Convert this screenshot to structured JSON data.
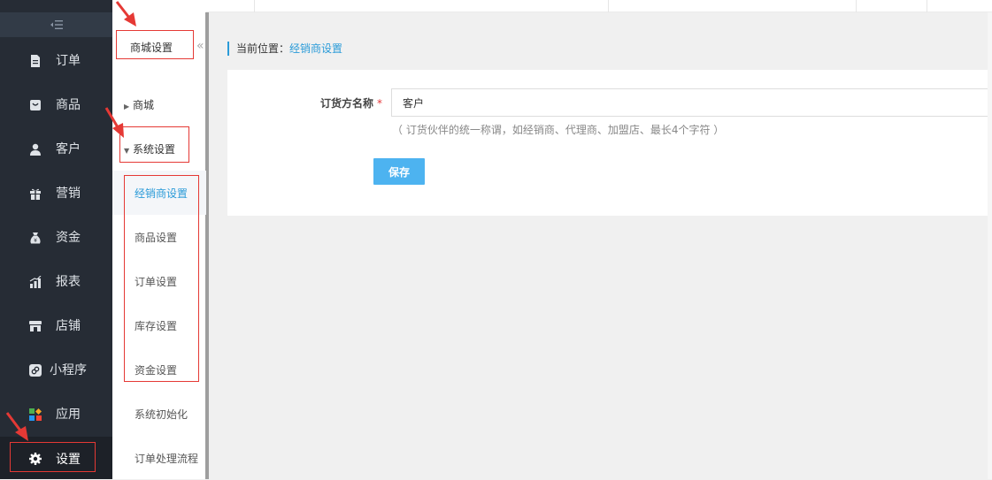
{
  "nav": {
    "collapse_icon": "menu-collapse-icon",
    "items": [
      {
        "label": "订单",
        "icon": "document-icon"
      },
      {
        "label": "商品",
        "icon": "bag-icon"
      },
      {
        "label": "客户",
        "icon": "user-icon"
      },
      {
        "label": "营销",
        "icon": "gift-icon"
      },
      {
        "label": "资金",
        "icon": "money-bag-icon"
      },
      {
        "label": "报表",
        "icon": "chart-icon"
      },
      {
        "label": "店铺",
        "icon": "store-icon"
      },
      {
        "label": "小程序",
        "icon": "miniprogram-icon"
      },
      {
        "label": "应用",
        "icon": "apps-icon"
      },
      {
        "label": "设置",
        "icon": "gear-icon",
        "active": true
      }
    ]
  },
  "submenu": {
    "title": "商城设置",
    "groups": [
      {
        "label": "商城",
        "expanded": false
      },
      {
        "label": "系统设置",
        "expanded": true
      }
    ],
    "items": [
      {
        "label": "经销商设置",
        "active": true
      },
      {
        "label": "商品设置"
      },
      {
        "label": "订单设置"
      },
      {
        "label": "库存设置"
      },
      {
        "label": "资金设置"
      },
      {
        "label": "系统初始化"
      },
      {
        "label": "订单处理流程"
      }
    ]
  },
  "breadcrumb": {
    "prefix": "当前位置：",
    "current": "经销商设置"
  },
  "form": {
    "field_label": "订货方名称",
    "required_mark": "*",
    "field_value": "客户",
    "hint": "（ 订货伙伴的统一称谓，如经销商、代理商、加盟店、最长4个字符 ）",
    "save_label": "保存"
  },
  "colors": {
    "nav_bg": "#262c35",
    "accent": "#2a9bd8",
    "button": "#4db3f0",
    "annotation": "#e53935"
  }
}
